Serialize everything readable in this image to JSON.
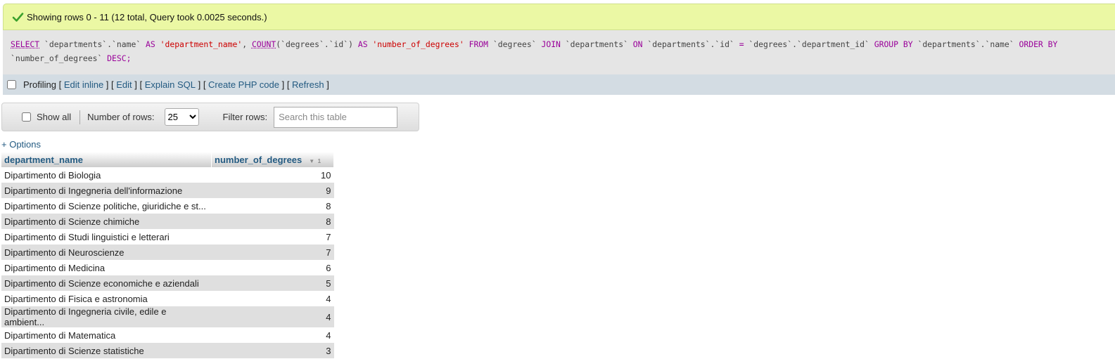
{
  "success_message": "Showing rows 0 - 11 (12 total, Query took 0.0025 seconds.)",
  "sql": {
    "select": "SELECT",
    "t1": "`departments`",
    "dot": ".",
    "c1": "`name`",
    "as": "AS",
    "alias1": "'department_name'",
    "comma": ",",
    "count": "COUNT",
    "paren_open": "(",
    "t2": "`degrees`",
    "c2": "`id`",
    "paren_close": ")",
    "alias2": "'number_of_degrees'",
    "from": "FROM",
    "join": "JOIN",
    "on": "ON",
    "eq": "=",
    "c3": "`department_id`",
    "group_by": "GROUP BY",
    "order_by": "ORDER BY",
    "c4": "`number_of_degrees`",
    "desc": "DESC;"
  },
  "profiling": {
    "label": "Profiling",
    "links": [
      "Edit inline",
      "Edit",
      "Explain SQL",
      "Create PHP code",
      "Refresh"
    ]
  },
  "navbar": {
    "show_all": "Show all",
    "rows_label": "Number of rows:",
    "rows_value": "25",
    "filter_label": "Filter rows:",
    "filter_placeholder": "Search this table"
  },
  "options_link": "+ Options",
  "table": {
    "columns": [
      "department_name",
      "number_of_degrees"
    ],
    "sort_indicator": "1",
    "rows": [
      [
        "Dipartimento di Biologia",
        "10"
      ],
      [
        "Dipartimento di Ingegneria dell'informazione",
        "9"
      ],
      [
        "Dipartimento di Scienze politiche, giuridiche e st...",
        "8"
      ],
      [
        "Dipartimento di Scienze chimiche",
        "8"
      ],
      [
        "Dipartimento di Studi linguistici e letterari",
        "7"
      ],
      [
        "Dipartimento di Neuroscienze",
        "7"
      ],
      [
        "Dipartimento di Medicina",
        "6"
      ],
      [
        "Dipartimento di Scienze economiche e aziendali",
        "5"
      ],
      [
        "Dipartimento di Fisica e astronomia",
        "4"
      ],
      [
        "Dipartimento di Ingegneria civile, edile e ambient...",
        "4"
      ],
      [
        "Dipartimento di Matematica",
        "4"
      ],
      [
        "Dipartimento di Scienze statistiche",
        "3"
      ]
    ]
  },
  "colors": {
    "success_bg": "#ebf8a4",
    "link": "#235a81",
    "keyword": "#990099",
    "string": "#cc0000"
  }
}
